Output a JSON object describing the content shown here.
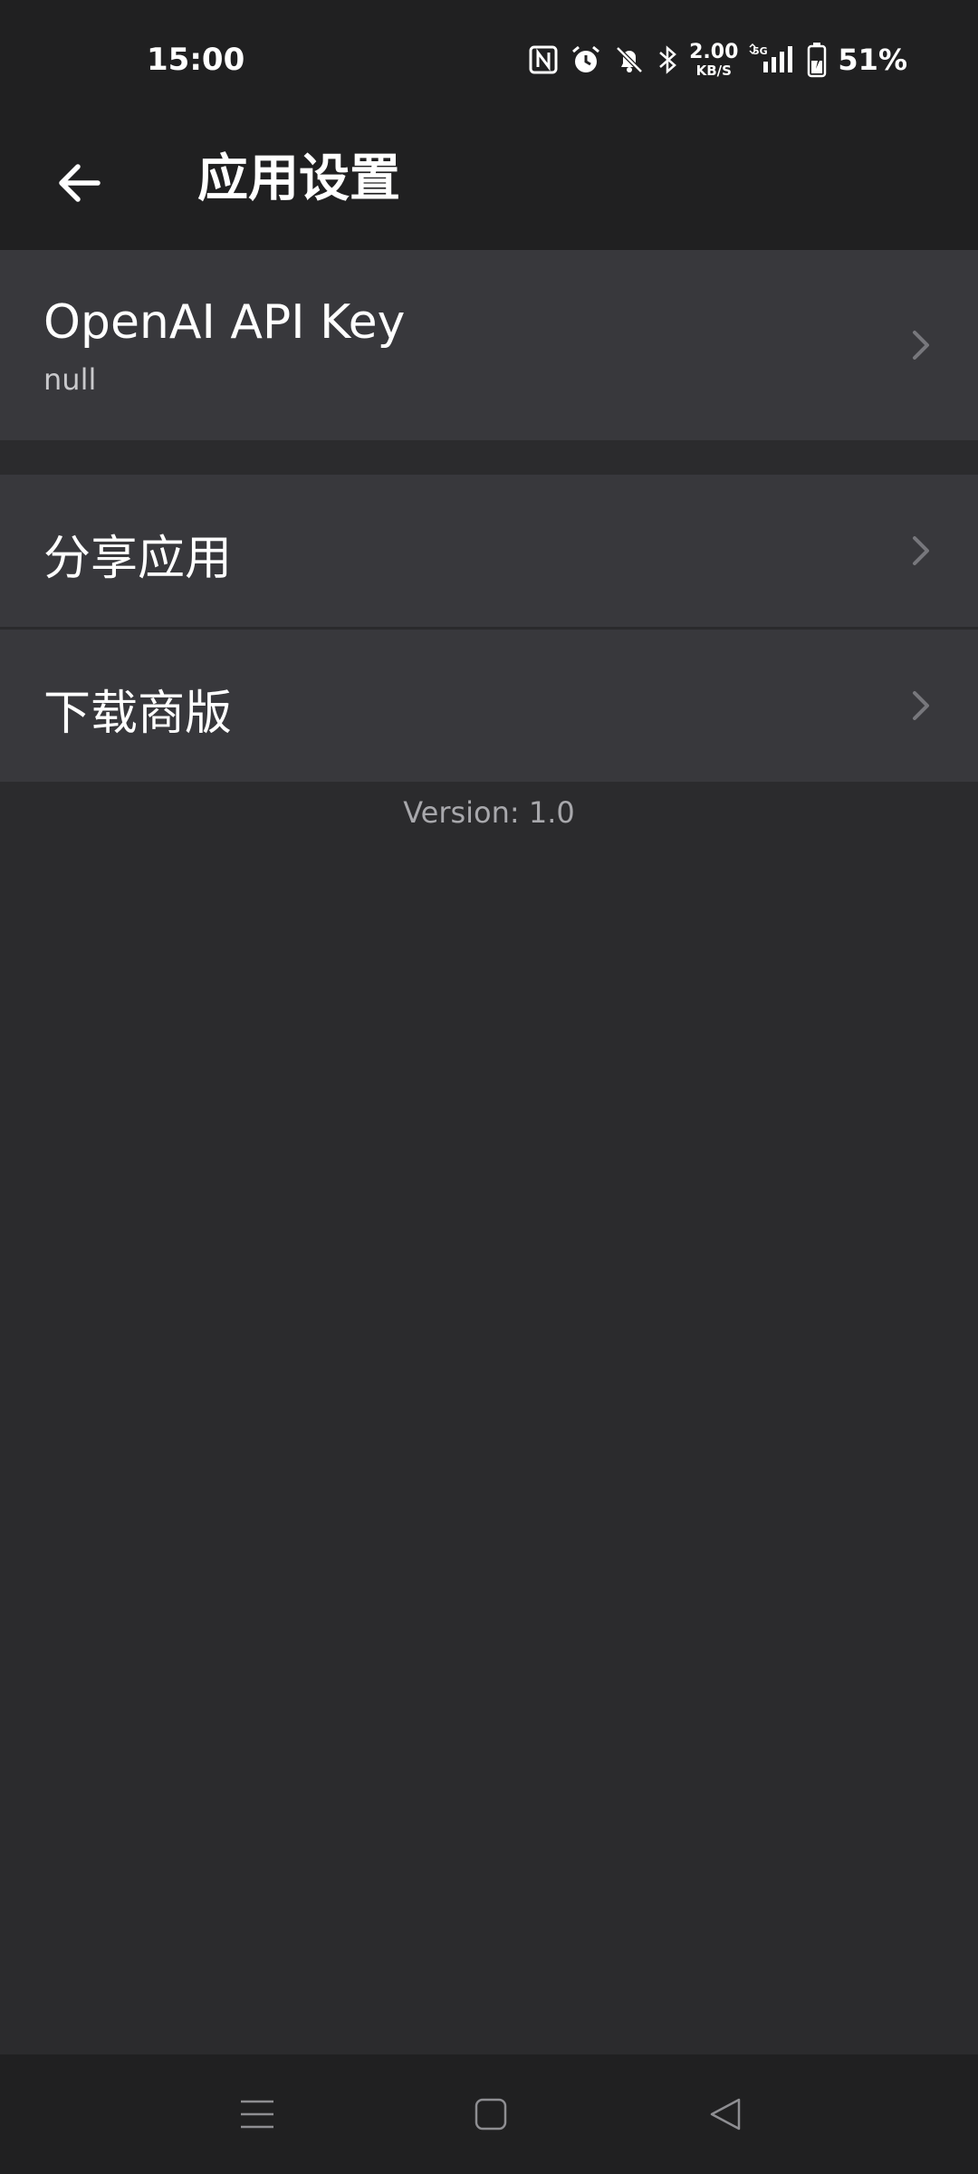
{
  "status_bar": {
    "time": "15:00",
    "net_speed_value": "2.00",
    "net_speed_unit": "KB/S",
    "network_type": "5G",
    "battery_percent": "51%",
    "icons": [
      "nfc-icon",
      "alarm-icon",
      "bell-off-icon",
      "bluetooth-icon",
      "signal-icon",
      "battery-charging-icon"
    ]
  },
  "app_bar": {
    "title": "应用设置",
    "back_icon": "arrow-left-icon"
  },
  "settings": {
    "items": [
      {
        "title": "OpenAI API Key",
        "subtitle": "null"
      },
      {
        "title": "分享应用"
      },
      {
        "title": "下载商版"
      }
    ]
  },
  "footer": {
    "version": "Version: 1.0"
  },
  "nav_bar": {
    "icons": [
      "menu-icon",
      "home-icon",
      "back-triangle-icon"
    ]
  },
  "colors": {
    "background": "#2b2b2d",
    "bar": "#202021",
    "row": "#38383c",
    "text_primary": "#ffffff",
    "text_secondary": "#a8a8ac"
  }
}
